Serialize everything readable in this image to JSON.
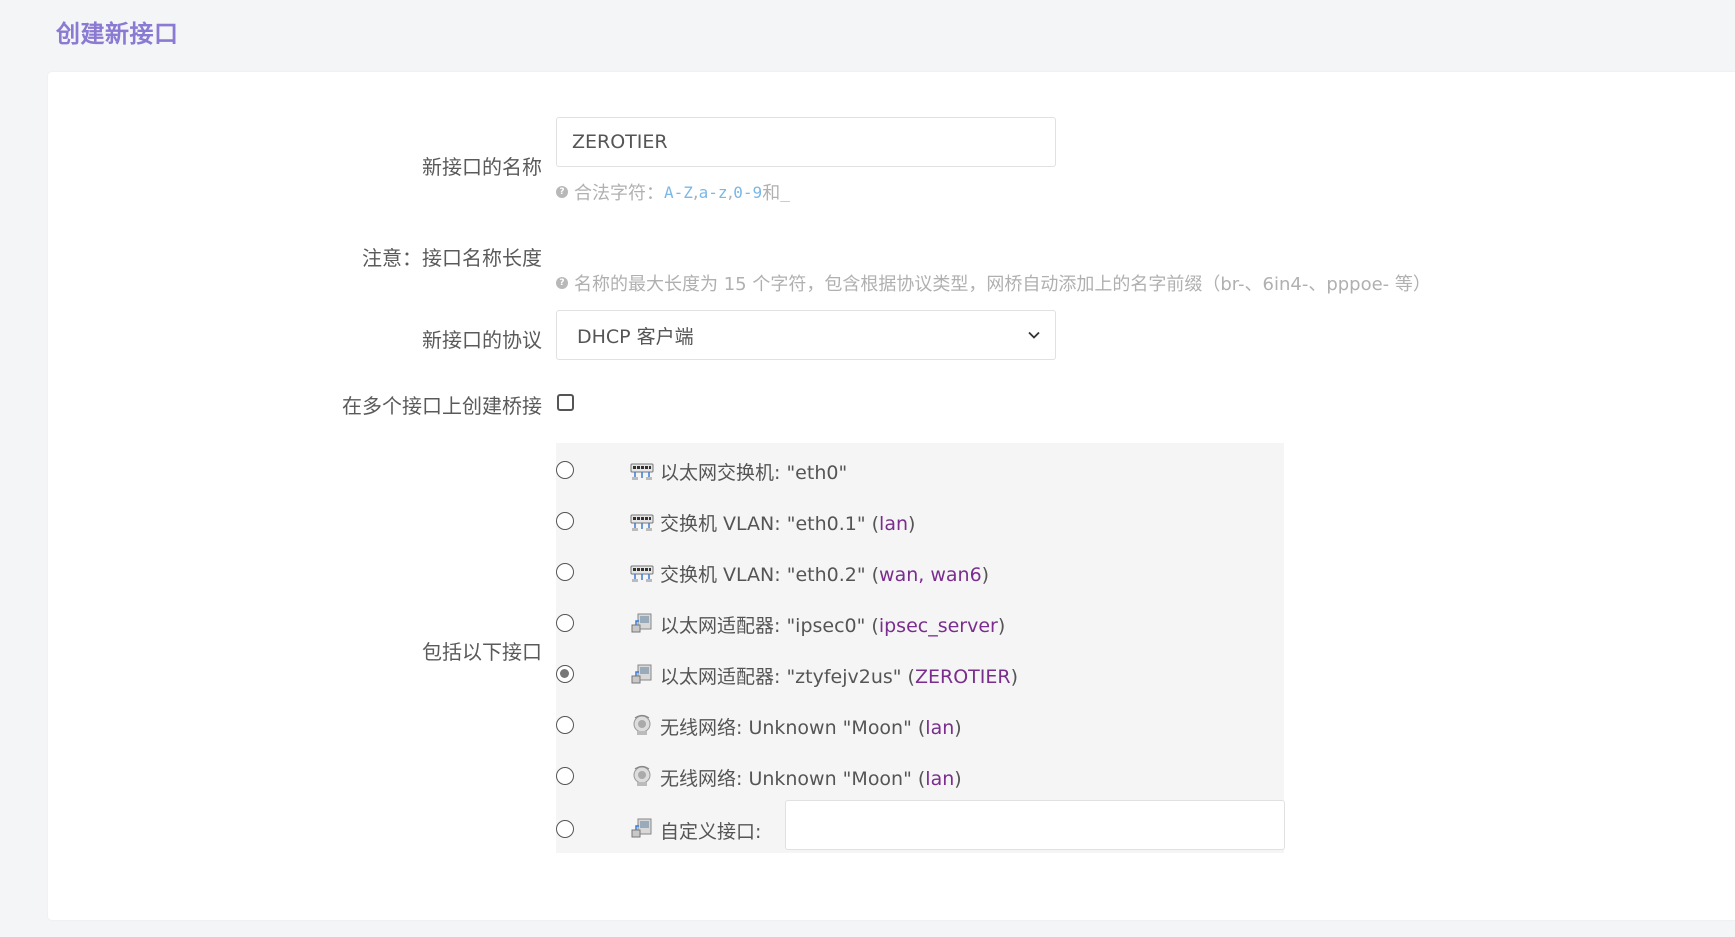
{
  "page": {
    "title": "创建新接口"
  },
  "form": {
    "name_label": "新接口的名称",
    "name_value": "ZEROTIER",
    "name_hint_prefix": "合法字符：",
    "name_hint_az_upper": "A-Z",
    "name_hint_sep1": ", ",
    "name_hint_az_lower": "a-z",
    "name_hint_sep2": ", ",
    "name_hint_digits": "0-9",
    "name_hint_and": " 和 ",
    "name_hint_underscore": "_",
    "note_label": "注意：接口名称长度",
    "note_hint": "名称的最大长度为 15 个字符，包含根据协议类型，网桥自动添加上的名字前缀（br-、6in4-、pppoe- 等）",
    "protocol_label": "新接口的协议",
    "protocol_value": "DHCP 客户端",
    "bridge_label": "在多个接口上创建桥接",
    "include_label": "包括以下接口",
    "custom_label": "自定义接口:",
    "custom_value": ""
  },
  "interfaces": [
    {
      "icon": "switch-icon",
      "text": "以太网交换机: \"eth0\"",
      "nets": "",
      "checked": false
    },
    {
      "icon": "switch-icon",
      "text": "交换机 VLAN: \"eth0.1\" (",
      "nets": "lan",
      "suffix": ")",
      "checked": false
    },
    {
      "icon": "switch-icon",
      "text": "交换机 VLAN: \"eth0.2\" (",
      "nets": "wan, wan6",
      "suffix": ")",
      "checked": false
    },
    {
      "icon": "ethernet-icon",
      "text": "以太网适配器: \"ipsec0\" (",
      "nets": "ipsec_server",
      "suffix": ")",
      "checked": false
    },
    {
      "icon": "ethernet-icon",
      "text": "以太网适配器: \"ztyfejv2us\" (",
      "nets": "ZEROTIER",
      "suffix": ")",
      "checked": true
    },
    {
      "icon": "wifi-icon",
      "text": "无线网络: Unknown \"Moon\" (",
      "nets": "lan",
      "suffix": ")",
      "checked": false
    },
    {
      "icon": "wifi-icon",
      "text": "无线网络: Unknown \"Moon\" (",
      "nets": "lan",
      "suffix": ")",
      "checked": false
    }
  ],
  "colors": {
    "title": "#8a7ad3",
    "network_link": "#7a2d8e",
    "hint_code": "#7ab8e6"
  }
}
